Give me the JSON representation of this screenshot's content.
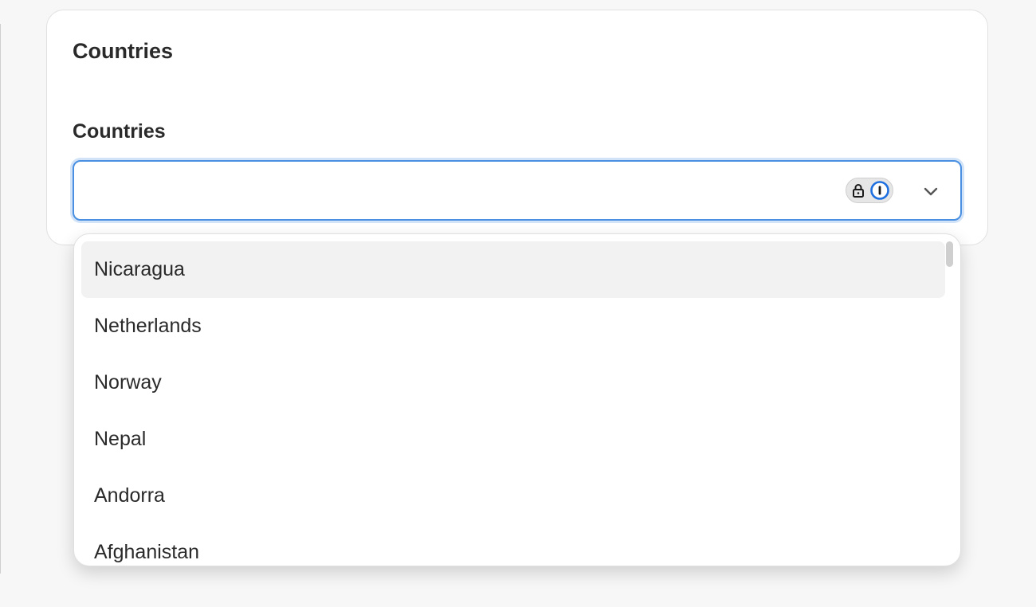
{
  "card": {
    "title": "Countries"
  },
  "field": {
    "label": "Countries",
    "value": "",
    "placeholder": ""
  },
  "icons": {
    "password_manager_lock": "lock-icon",
    "password_manager_key": "1password-icon",
    "dropdown_toggle": "chevron-down-icon"
  },
  "dropdown": {
    "highlighted_index": 0,
    "options": [
      {
        "label": "Nicaragua"
      },
      {
        "label": "Netherlands"
      },
      {
        "label": "Norway"
      },
      {
        "label": "Nepal"
      },
      {
        "label": "Andorra"
      },
      {
        "label": "Afghanistan"
      }
    ]
  },
  "colors": {
    "focus_border": "#4a90e2",
    "highlight_bg": "#f2f2f2",
    "page_bg": "#f7f7f7"
  }
}
